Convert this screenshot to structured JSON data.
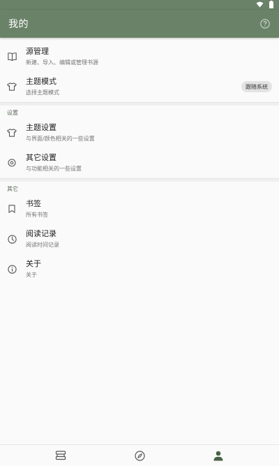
{
  "app_bar": {
    "title": "我的"
  },
  "sections": [
    {
      "header": "",
      "items": [
        {
          "title": "源管理",
          "subtitle": "新建、导入、编辑或管理书源",
          "icon": "book-open-icon"
        },
        {
          "title": "主题模式",
          "subtitle": "选择主题模式",
          "icon": "tshirt-icon",
          "chip": "跟随系统"
        }
      ]
    },
    {
      "header": "设置",
      "items": [
        {
          "title": "主题设置",
          "subtitle": "与界面/颜色相关的一些设置",
          "icon": "tshirt-icon"
        },
        {
          "title": "其它设置",
          "subtitle": "与功能相关的一些设置",
          "icon": "settings-icon"
        }
      ]
    },
    {
      "header": "其它",
      "items": [
        {
          "title": "书签",
          "subtitle": "所有书签",
          "icon": "bookmark-icon"
        },
        {
          "title": "阅读记录",
          "subtitle": "阅读时间记录",
          "icon": "clock-icon"
        },
        {
          "title": "关于",
          "subtitle": "关于",
          "icon": "info-icon"
        }
      ]
    }
  ],
  "bottom_nav": [
    {
      "icon": "bookshelf-icon",
      "selected": false
    },
    {
      "icon": "compass-icon",
      "selected": false
    },
    {
      "icon": "person-icon",
      "selected": true
    }
  ],
  "colors": {
    "app_bar": "#6a8268",
    "background": "#fafafa",
    "chip": "#e3e3e3",
    "selected_nav": "#4a6248"
  }
}
